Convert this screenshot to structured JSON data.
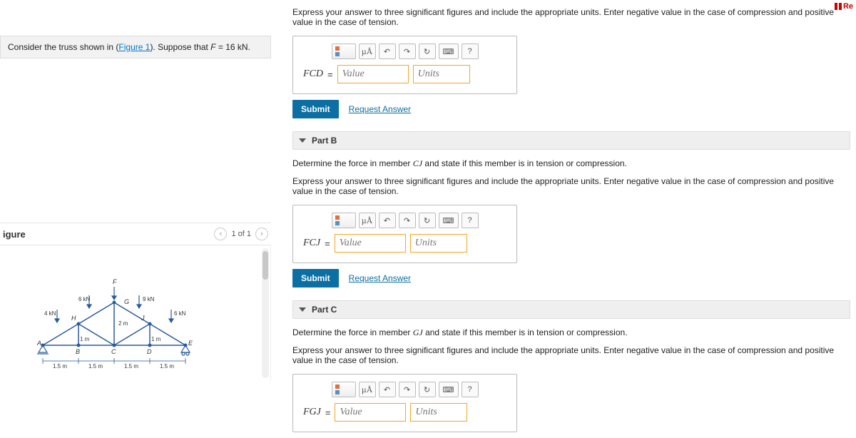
{
  "topReview": "Re",
  "problem": {
    "prefix": "Consider the truss shown in (",
    "figlink": "Figure 1",
    "suffix": "). Suppose that ",
    "var": "F",
    "eq": " = 16 ",
    "unit": "kN",
    "period": "."
  },
  "figure": {
    "label": "igure",
    "counter": "1 of 1",
    "labels": {
      "F": "F",
      "G": "G",
      "H": "H",
      "J": "J",
      "A": "A",
      "B": "B",
      "C": "C",
      "D": "D",
      "E": "E",
      "load4": "4 kN",
      "load6a": "6 kN",
      "load9": "9 kN",
      "load6b": "6 kN",
      "dim2m": "2 m",
      "dim1ma": "1 m",
      "dim1mb": "1 m",
      "d1": "1.5 m",
      "d2": "1.5 m",
      "d3": "1.5 m",
      "d4": "1.5 m"
    }
  },
  "partA": {
    "instr": "Express your answer to three significant figures and include the appropriate units. Enter negative value in the case of compression and positive value in the case of tension.",
    "var": "FCD",
    "valuePlaceholder": "Value",
    "unitsPlaceholder": "Units",
    "submit": "Submit",
    "request": "Request Answer",
    "toolbar": {
      "mu": "µÅ",
      "undo": "↶",
      "redo": "↷",
      "reset": "↻",
      "kbd": "⌨",
      "help": "?"
    }
  },
  "partB": {
    "title": "Part B",
    "q1a": "Determine the force in member ",
    "q1var": "CJ",
    "q1b": " and state if this member is in tension or compression.",
    "instr": "Express your answer to three significant figures and include the appropriate units. Enter negative value in the case of compression and positive value in the case of tension.",
    "var": "FCJ",
    "valuePlaceholder": "Value",
    "unitsPlaceholder": "Units",
    "submit": "Submit",
    "request": "Request Answer",
    "toolbar": {
      "mu": "µÅ",
      "undo": "↶",
      "redo": "↷",
      "reset": "↻",
      "kbd": "⌨",
      "help": "?"
    }
  },
  "partC": {
    "title": "Part C",
    "q1a": "Determine the force in member ",
    "q1var": "GJ",
    "q1b": " and state if this member is in tension or compression.",
    "instr": "Express your answer to three significant figures and include the appropriate units. Enter negative value in the case of compression and positive value in the case of tension.",
    "var": "FGJ",
    "valuePlaceholder": "Value",
    "unitsPlaceholder": "Units",
    "toolbar": {
      "mu": "µÅ",
      "undo": "↶",
      "redo": "↷",
      "reset": "↻",
      "kbd": "⌨",
      "help": "?"
    }
  }
}
